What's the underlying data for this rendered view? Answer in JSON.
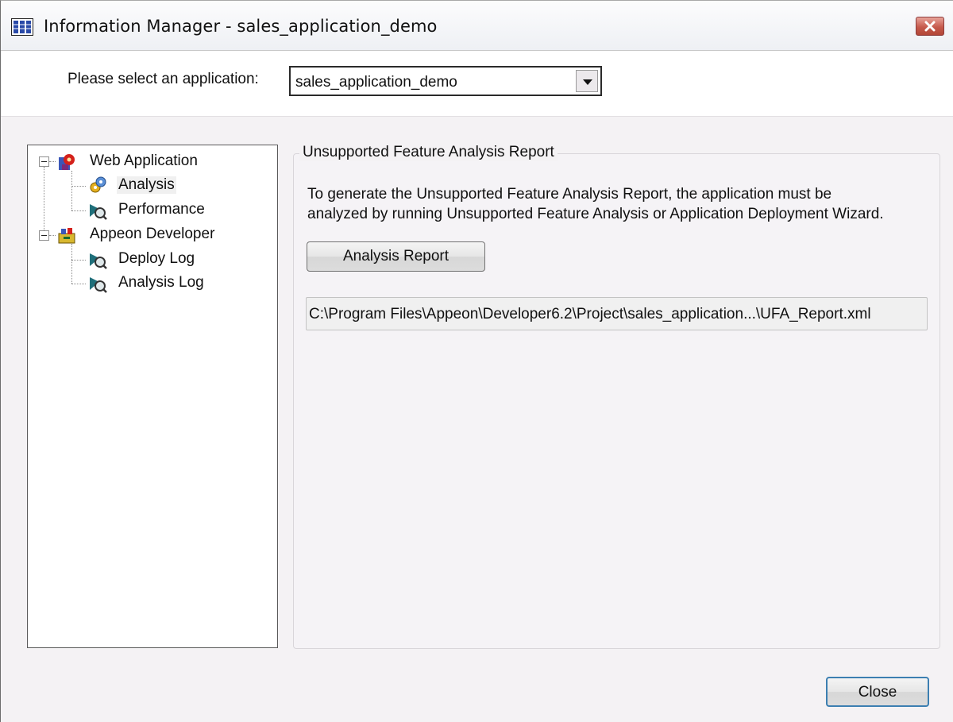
{
  "window": {
    "title": "Information Manager - sales_application_demo"
  },
  "selector": {
    "label": "Please select an application:",
    "value": "sales_application_demo"
  },
  "tree": {
    "items": [
      {
        "label": "Web Application",
        "icon": "gear-puzzle-icon"
      },
      {
        "label": "Analysis",
        "icon": "analysis-gears-icon"
      },
      {
        "label": "Performance",
        "icon": "magnifier-icon"
      },
      {
        "label": "Appeon Developer",
        "icon": "developer-toolbox-icon"
      },
      {
        "label": "Deploy Log",
        "icon": "magnifier-icon"
      },
      {
        "label": "Analysis Log",
        "icon": "magnifier-icon"
      }
    ]
  },
  "report": {
    "group_title": "Unsupported Feature Analysis Report",
    "desc_line1": "To generate the Unsupported Feature Analysis Report, the application must be",
    "desc_line2": "analyzed by running Unsupported Feature Analysis or Application Deployment Wizard.",
    "button_label": "Analysis Report",
    "path": "C:\\Program Files\\Appeon\\Developer6.2\\Project\\sales_application...\\UFA_Report.xml"
  },
  "footer": {
    "close_label": "Close"
  },
  "colors": {
    "close_button_border": "#3c7fb1",
    "title_close_red": "#c65a4c"
  }
}
